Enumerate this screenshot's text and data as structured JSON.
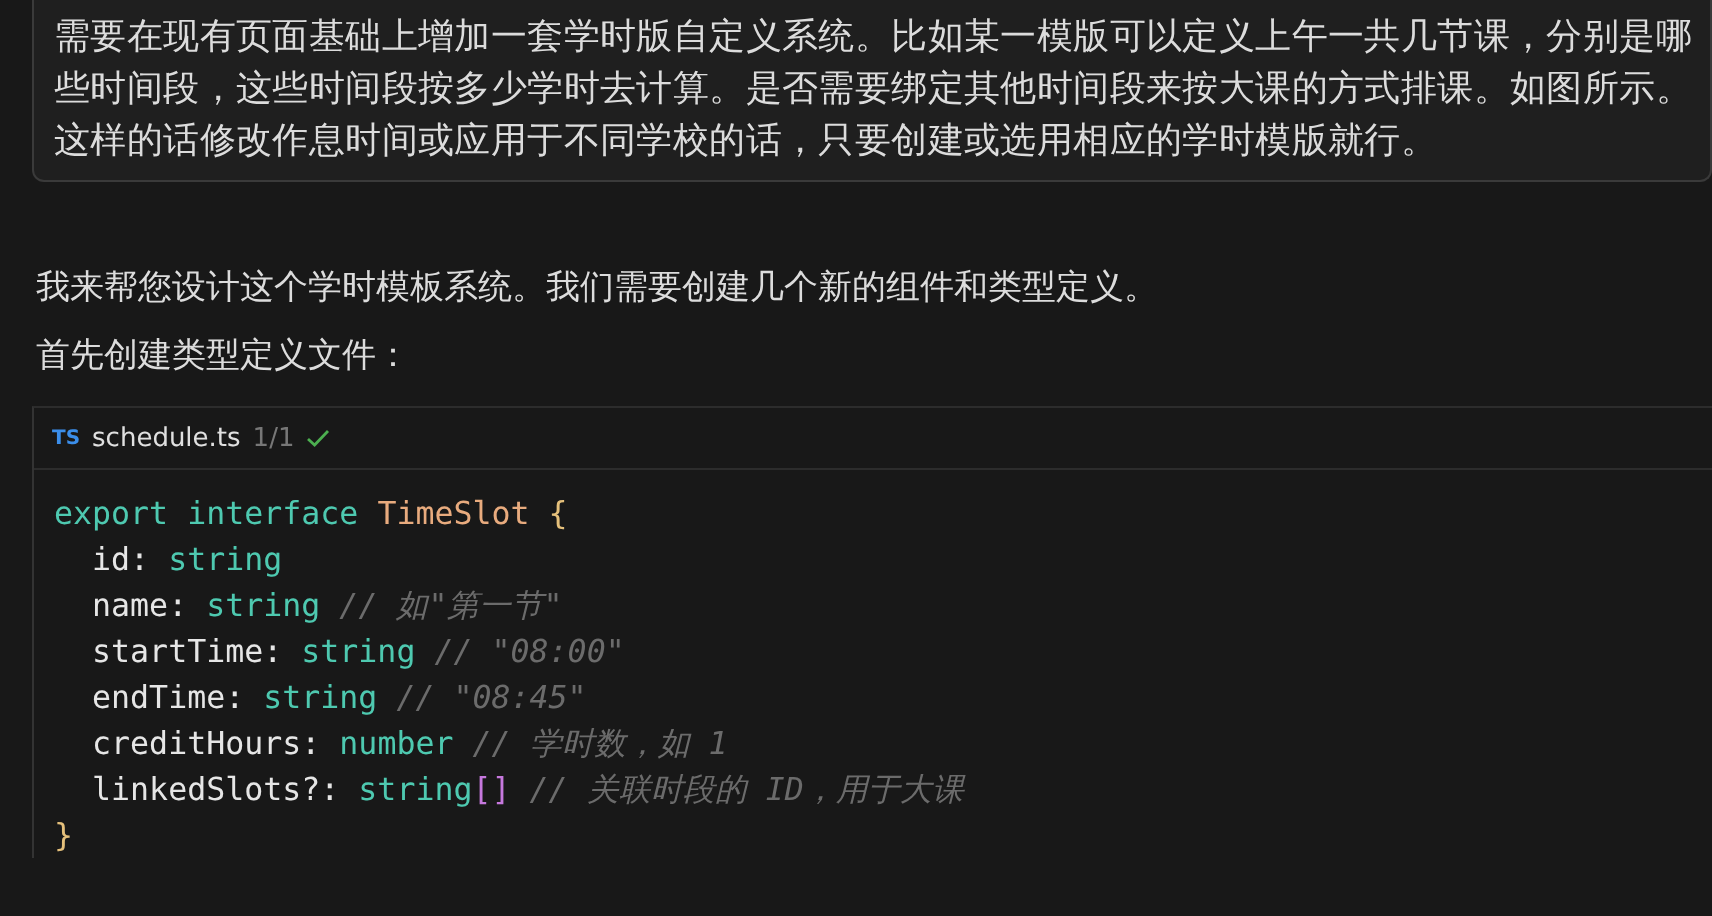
{
  "prompt": "需要在现有页面基础上增加一套学时版自定义系统。比如某一模版可以定义上午一共几节课，分别是哪些时间段，这些时间段按多少学时去计算。是否需要绑定其他时间段来按大课的方式排课。如图所示。这样的话修改作息时间或应用于不同学校的话，只要创建或选用相应的学时模版就行。",
  "reply": [
    "我来帮您设计这个学时模板系统。我们需要创建几个新的组件和类型定义。",
    "首先创建类型定义文件："
  ],
  "code_block": {
    "language_badge": "TS",
    "file_name": "schedule.ts",
    "edit_count": "1/1",
    "applied": true,
    "lines": [
      [
        {
          "kind": "keyword",
          "text": "export interface "
        },
        {
          "kind": "type",
          "text": "TimeSlot "
        },
        {
          "kind": "brace",
          "text": "{"
        }
      ],
      [
        {
          "kind": "plain",
          "text": "  id: "
        },
        {
          "kind": "keyword",
          "text": "string"
        }
      ],
      [
        {
          "kind": "plain",
          "text": "  name: "
        },
        {
          "kind": "keyword",
          "text": "string"
        },
        {
          "kind": "comment",
          "text": " // 如\"第一节\""
        }
      ],
      [
        {
          "kind": "plain",
          "text": "  startTime: "
        },
        {
          "kind": "keyword",
          "text": "string"
        },
        {
          "kind": "comment",
          "text": " // \"08:00\""
        }
      ],
      [
        {
          "kind": "plain",
          "text": "  endTime: "
        },
        {
          "kind": "keyword",
          "text": "string"
        },
        {
          "kind": "comment",
          "text": " // \"08:45\""
        }
      ],
      [
        {
          "kind": "plain",
          "text": "  creditHours: "
        },
        {
          "kind": "keyword",
          "text": "number"
        },
        {
          "kind": "comment",
          "text": " // 学时数，如 1"
        }
      ],
      [
        {
          "kind": "plain",
          "text": "  linkedSlots?: "
        },
        {
          "kind": "keyword",
          "text": "string"
        },
        {
          "kind": "bracket",
          "text": "[]"
        },
        {
          "kind": "comment",
          "text": " // 关联时段的 ID，用于大课"
        }
      ],
      [
        {
          "kind": "brace",
          "text": "}"
        }
      ]
    ]
  }
}
